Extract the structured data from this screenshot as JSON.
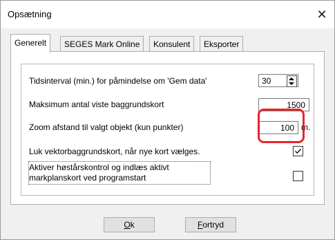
{
  "window": {
    "title": "Opsætning"
  },
  "tabs": [
    {
      "label": "Generelt",
      "active": true
    },
    {
      "label": "SEGES Mark Online",
      "active": false
    },
    {
      "label": "Konsulent",
      "active": false
    },
    {
      "label": "Eksporter",
      "active": false
    }
  ],
  "settings": {
    "save_interval": {
      "label": "Tidsinterval (min.) for påmindelse om 'Gem data'",
      "value": "30"
    },
    "max_background_maps": {
      "label": "Maksimum antal viste baggrundskort",
      "value": "1500"
    },
    "zoom_distance": {
      "label": "Zoom afstand til valgt objekt (kun punkter)",
      "value": "100",
      "unit": "m."
    },
    "close_vector_maps": {
      "label": "Luk vektorbaggrundskort, når nye kort vælges.",
      "checked": true
    },
    "harvest_check": {
      "label_line1": "Aktiver høstårskontrol og indlæs aktivt",
      "label_line2": "markplanskort ved programstart",
      "checked": false
    }
  },
  "buttons": {
    "ok": {
      "underline": "O",
      "rest": "k"
    },
    "cancel": {
      "underline": "F",
      "rest": "ortryd"
    }
  },
  "colors": {
    "highlight": "#e8232a"
  },
  "icons": {
    "close": "close-icon",
    "check": "checkmark-icon"
  }
}
